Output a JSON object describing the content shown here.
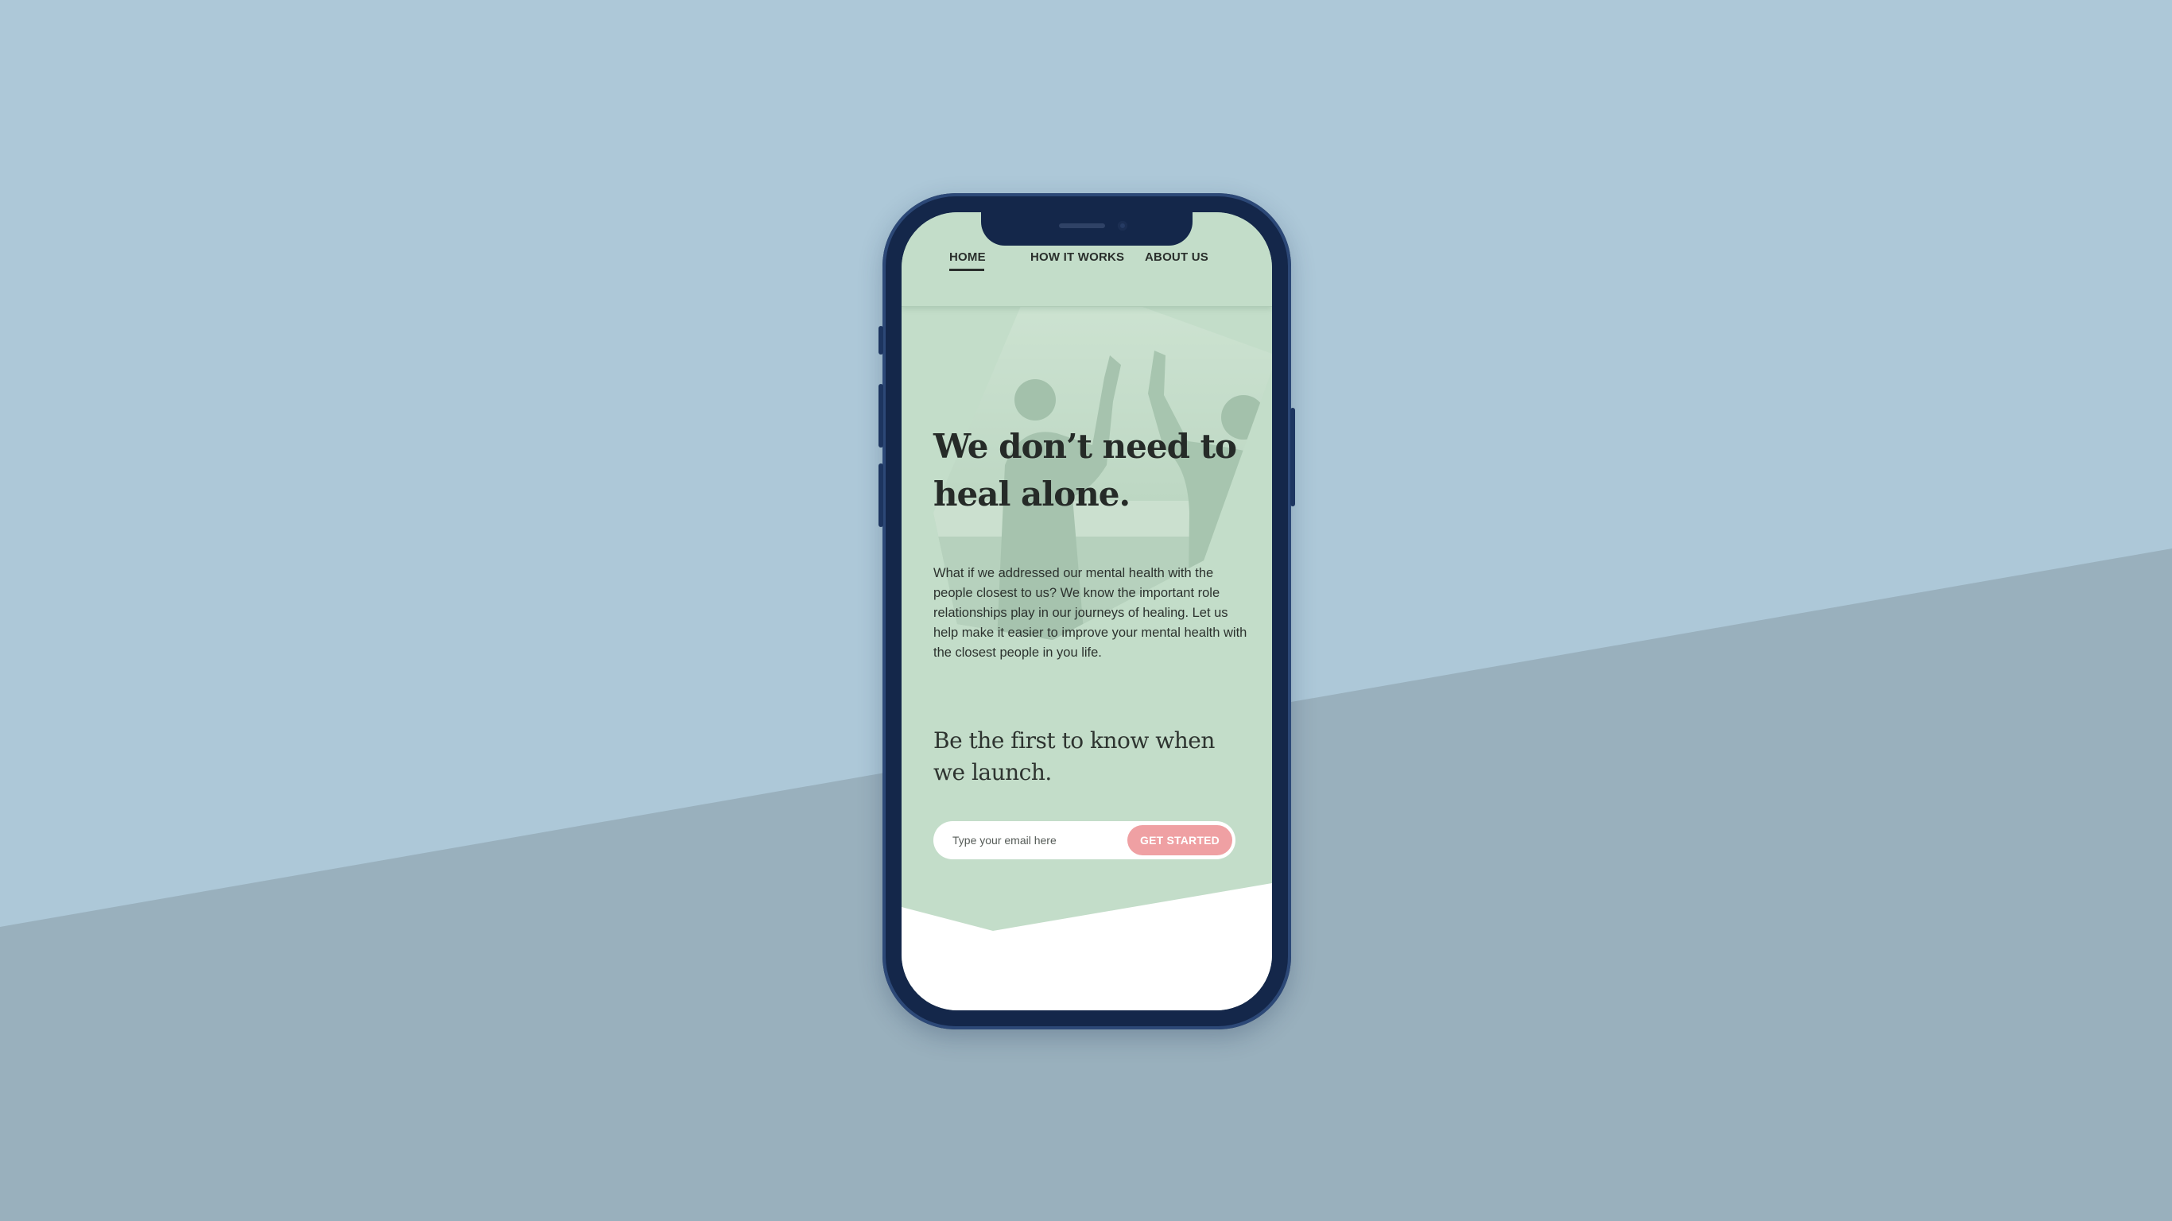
{
  "colors": {
    "background_top": "#adc8d8",
    "background_bottom": "#99b0bd",
    "phone_frame": "#14274a",
    "screen_bg": "#c3ddc9",
    "accent_button": "#efa0a3",
    "text_dark": "#262b28"
  },
  "nav": {
    "items": [
      {
        "label": "HOME",
        "active": true
      },
      {
        "label": "HOW IT WORKS",
        "active": false
      },
      {
        "label": "ABOUT US",
        "active": false
      }
    ]
  },
  "hero": {
    "image": "two-people-high-five-on-beach",
    "headline": "We don’t need to heal alone.",
    "body": "What if we addressed our mental health with the people closest to us? We know the important role relationships play in our journeys of healing. Let us help make it easier to improve your mental health with the closest people in you life."
  },
  "signup": {
    "heading": "Be the first to know when we launch.",
    "email_placeholder": "Type your email here",
    "email_value": "",
    "button_label": "GET STARTED"
  }
}
